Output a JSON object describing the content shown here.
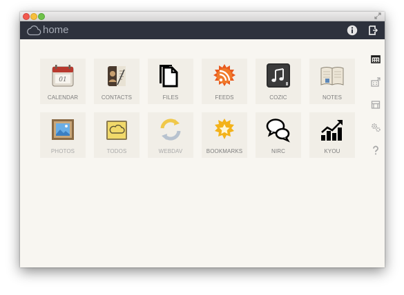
{
  "header": {
    "title": "home",
    "icons": {
      "cloud": "cloud-icon",
      "info": "info-icon",
      "logout": "logout-icon"
    }
  },
  "apps": [
    {
      "label": "CALENDAR",
      "icon": "calendar-icon"
    },
    {
      "label": "CONTACTS",
      "icon": "contacts-book-icon"
    },
    {
      "label": "FILES",
      "icon": "files-icon"
    },
    {
      "label": "FEEDS",
      "icon": "rss-feed-icon"
    },
    {
      "label": "COZIC",
      "icon": "music-note-icon"
    },
    {
      "label": "NOTES",
      "icon": "notebook-icon"
    },
    {
      "label": "PHOTOS",
      "icon": "photo-frame-icon"
    },
    {
      "label": "TODOS",
      "icon": "todo-note-icon"
    },
    {
      "label": "WEBDAV",
      "icon": "sync-arrows-icon"
    },
    {
      "label": "BOOKMARKS",
      "icon": "bookmark-star-icon"
    },
    {
      "label": "NIRC",
      "icon": "chat-bubbles-icon"
    },
    {
      "label": "KYOU",
      "icon": "bar-chart-icon"
    }
  ],
  "sidebar": [
    {
      "icon": "apps-grid-icon",
      "active": true
    },
    {
      "icon": "app-store-icon",
      "active": false
    },
    {
      "icon": "market-icon",
      "active": false
    },
    {
      "icon": "settings-gears-icon",
      "active": false
    },
    {
      "icon": "help-icon",
      "active": false
    }
  ],
  "colors": {
    "header_bg": "#2e323d",
    "content_bg": "#f8f6f1",
    "tile_bg": "#f1eee7",
    "label_text": "#7d7d7d"
  }
}
